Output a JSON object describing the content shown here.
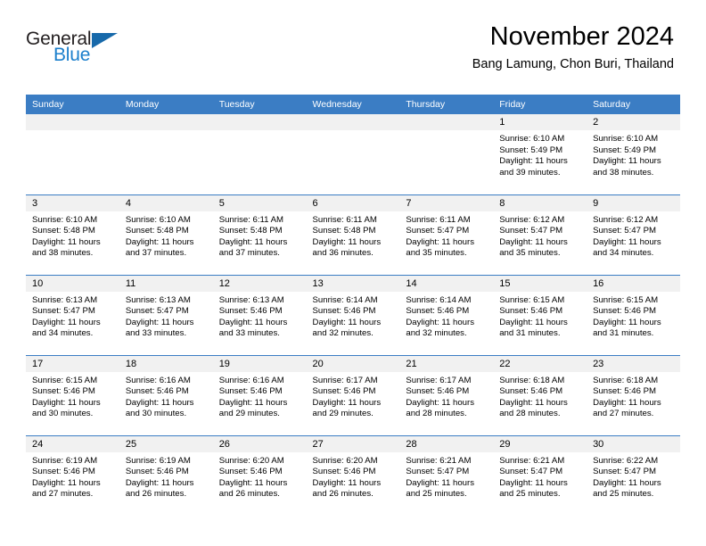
{
  "brand": {
    "name_part1": "General",
    "name_part2": "Blue"
  },
  "header": {
    "title": "November 2024",
    "subtitle": "Bang Lamung, Chon Buri, Thailand"
  },
  "colors": {
    "header_blue": "#3b7dc4",
    "brand_blue": "#1b7fcc",
    "daynum_band": "#f1f1f1"
  },
  "weekday_headers": [
    "Sunday",
    "Monday",
    "Tuesday",
    "Wednesday",
    "Thursday",
    "Friday",
    "Saturday"
  ],
  "weeks": [
    [
      {
        "day": "",
        "empty": true
      },
      {
        "day": "",
        "empty": true
      },
      {
        "day": "",
        "empty": true
      },
      {
        "day": "",
        "empty": true
      },
      {
        "day": "",
        "empty": true
      },
      {
        "day": "1",
        "sunrise": "Sunrise: 6:10 AM",
        "sunset": "Sunset: 5:49 PM",
        "daylight": "Daylight: 11 hours and 39 minutes."
      },
      {
        "day": "2",
        "sunrise": "Sunrise: 6:10 AM",
        "sunset": "Sunset: 5:49 PM",
        "daylight": "Daylight: 11 hours and 38 minutes."
      }
    ],
    [
      {
        "day": "3",
        "sunrise": "Sunrise: 6:10 AM",
        "sunset": "Sunset: 5:48 PM",
        "daylight": "Daylight: 11 hours and 38 minutes."
      },
      {
        "day": "4",
        "sunrise": "Sunrise: 6:10 AM",
        "sunset": "Sunset: 5:48 PM",
        "daylight": "Daylight: 11 hours and 37 minutes."
      },
      {
        "day": "5",
        "sunrise": "Sunrise: 6:11 AM",
        "sunset": "Sunset: 5:48 PM",
        "daylight": "Daylight: 11 hours and 37 minutes."
      },
      {
        "day": "6",
        "sunrise": "Sunrise: 6:11 AM",
        "sunset": "Sunset: 5:48 PM",
        "daylight": "Daylight: 11 hours and 36 minutes."
      },
      {
        "day": "7",
        "sunrise": "Sunrise: 6:11 AM",
        "sunset": "Sunset: 5:47 PM",
        "daylight": "Daylight: 11 hours and 35 minutes."
      },
      {
        "day": "8",
        "sunrise": "Sunrise: 6:12 AM",
        "sunset": "Sunset: 5:47 PM",
        "daylight": "Daylight: 11 hours and 35 minutes."
      },
      {
        "day": "9",
        "sunrise": "Sunrise: 6:12 AM",
        "sunset": "Sunset: 5:47 PM",
        "daylight": "Daylight: 11 hours and 34 minutes."
      }
    ],
    [
      {
        "day": "10",
        "sunrise": "Sunrise: 6:13 AM",
        "sunset": "Sunset: 5:47 PM",
        "daylight": "Daylight: 11 hours and 34 minutes."
      },
      {
        "day": "11",
        "sunrise": "Sunrise: 6:13 AM",
        "sunset": "Sunset: 5:47 PM",
        "daylight": "Daylight: 11 hours and 33 minutes."
      },
      {
        "day": "12",
        "sunrise": "Sunrise: 6:13 AM",
        "sunset": "Sunset: 5:46 PM",
        "daylight": "Daylight: 11 hours and 33 minutes."
      },
      {
        "day": "13",
        "sunrise": "Sunrise: 6:14 AM",
        "sunset": "Sunset: 5:46 PM",
        "daylight": "Daylight: 11 hours and 32 minutes."
      },
      {
        "day": "14",
        "sunrise": "Sunrise: 6:14 AM",
        "sunset": "Sunset: 5:46 PM",
        "daylight": "Daylight: 11 hours and 32 minutes."
      },
      {
        "day": "15",
        "sunrise": "Sunrise: 6:15 AM",
        "sunset": "Sunset: 5:46 PM",
        "daylight": "Daylight: 11 hours and 31 minutes."
      },
      {
        "day": "16",
        "sunrise": "Sunrise: 6:15 AM",
        "sunset": "Sunset: 5:46 PM",
        "daylight": "Daylight: 11 hours and 31 minutes."
      }
    ],
    [
      {
        "day": "17",
        "sunrise": "Sunrise: 6:15 AM",
        "sunset": "Sunset: 5:46 PM",
        "daylight": "Daylight: 11 hours and 30 minutes."
      },
      {
        "day": "18",
        "sunrise": "Sunrise: 6:16 AM",
        "sunset": "Sunset: 5:46 PM",
        "daylight": "Daylight: 11 hours and 30 minutes."
      },
      {
        "day": "19",
        "sunrise": "Sunrise: 6:16 AM",
        "sunset": "Sunset: 5:46 PM",
        "daylight": "Daylight: 11 hours and 29 minutes."
      },
      {
        "day": "20",
        "sunrise": "Sunrise: 6:17 AM",
        "sunset": "Sunset: 5:46 PM",
        "daylight": "Daylight: 11 hours and 29 minutes."
      },
      {
        "day": "21",
        "sunrise": "Sunrise: 6:17 AM",
        "sunset": "Sunset: 5:46 PM",
        "daylight": "Daylight: 11 hours and 28 minutes."
      },
      {
        "day": "22",
        "sunrise": "Sunrise: 6:18 AM",
        "sunset": "Sunset: 5:46 PM",
        "daylight": "Daylight: 11 hours and 28 minutes."
      },
      {
        "day": "23",
        "sunrise": "Sunrise: 6:18 AM",
        "sunset": "Sunset: 5:46 PM",
        "daylight": "Daylight: 11 hours and 27 minutes."
      }
    ],
    [
      {
        "day": "24",
        "sunrise": "Sunrise: 6:19 AM",
        "sunset": "Sunset: 5:46 PM",
        "daylight": "Daylight: 11 hours and 27 minutes."
      },
      {
        "day": "25",
        "sunrise": "Sunrise: 6:19 AM",
        "sunset": "Sunset: 5:46 PM",
        "daylight": "Daylight: 11 hours and 26 minutes."
      },
      {
        "day": "26",
        "sunrise": "Sunrise: 6:20 AM",
        "sunset": "Sunset: 5:46 PM",
        "daylight": "Daylight: 11 hours and 26 minutes."
      },
      {
        "day": "27",
        "sunrise": "Sunrise: 6:20 AM",
        "sunset": "Sunset: 5:46 PM",
        "daylight": "Daylight: 11 hours and 26 minutes."
      },
      {
        "day": "28",
        "sunrise": "Sunrise: 6:21 AM",
        "sunset": "Sunset: 5:47 PM",
        "daylight": "Daylight: 11 hours and 25 minutes."
      },
      {
        "day": "29",
        "sunrise": "Sunrise: 6:21 AM",
        "sunset": "Sunset: 5:47 PM",
        "daylight": "Daylight: 11 hours and 25 minutes."
      },
      {
        "day": "30",
        "sunrise": "Sunrise: 6:22 AM",
        "sunset": "Sunset: 5:47 PM",
        "daylight": "Daylight: 11 hours and 25 minutes."
      }
    ]
  ]
}
